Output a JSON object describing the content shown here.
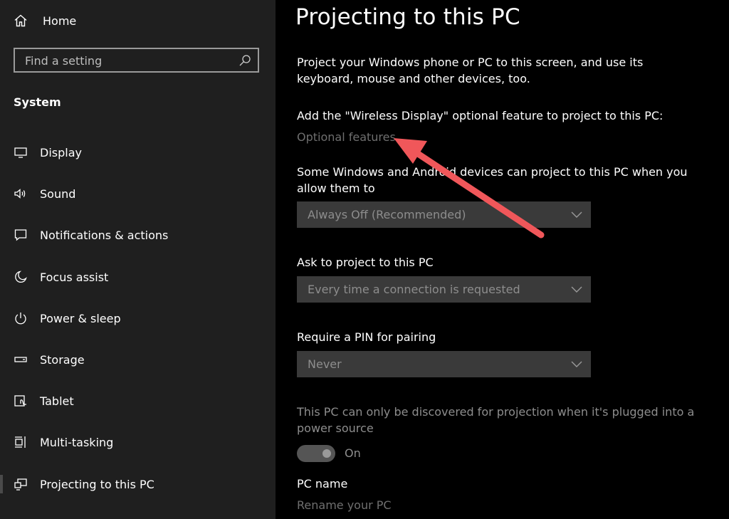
{
  "sidebar": {
    "home_label": "Home",
    "search_placeholder": "Find a setting",
    "section_title": "System",
    "items": [
      {
        "label": "Display",
        "icon": "monitor-icon"
      },
      {
        "label": "Sound",
        "icon": "speaker-icon"
      },
      {
        "label": "Notifications & actions",
        "icon": "notification-icon"
      },
      {
        "label": "Focus assist",
        "icon": "moon-icon"
      },
      {
        "label": "Power & sleep",
        "icon": "power-icon"
      },
      {
        "label": "Storage",
        "icon": "storage-icon"
      },
      {
        "label": "Tablet",
        "icon": "tablet-icon"
      },
      {
        "label": "Multi-tasking",
        "icon": "multitasking-icon"
      },
      {
        "label": "Projecting to this PC",
        "icon": "projecting-icon",
        "selected": true
      }
    ]
  },
  "main": {
    "title": "Projecting to this PC",
    "intro": "Project your Windows phone or PC to this screen, and use its keyboard, mouse and other devices, too.",
    "feature_prompt": "Add the \"Wireless Display\" optional feature to project to this PC:",
    "optional_features_link": "Optional features",
    "allow_text": "Some Windows and Android devices can project to this PC when you allow them to",
    "allow_dropdown_value": "Always Off (Recommended)",
    "ask_label": "Ask to project to this PC",
    "ask_dropdown_value": "Every time a connection is requested",
    "pin_label": "Require a PIN for pairing",
    "pin_dropdown_value": "Never",
    "power_text": "This PC can only be discovered for projection when it's plugged into a power source",
    "toggle_state": "On",
    "pc_name_label": "PC name",
    "rename_link": "Rename your PC"
  },
  "colors": {
    "sidebar_bg": "#1f1f1f",
    "main_bg": "#000000",
    "dropdown_bg": "#3a3a3a",
    "disabled_text": "#6f6f6f",
    "annotation_arrow": "#f0575a"
  }
}
